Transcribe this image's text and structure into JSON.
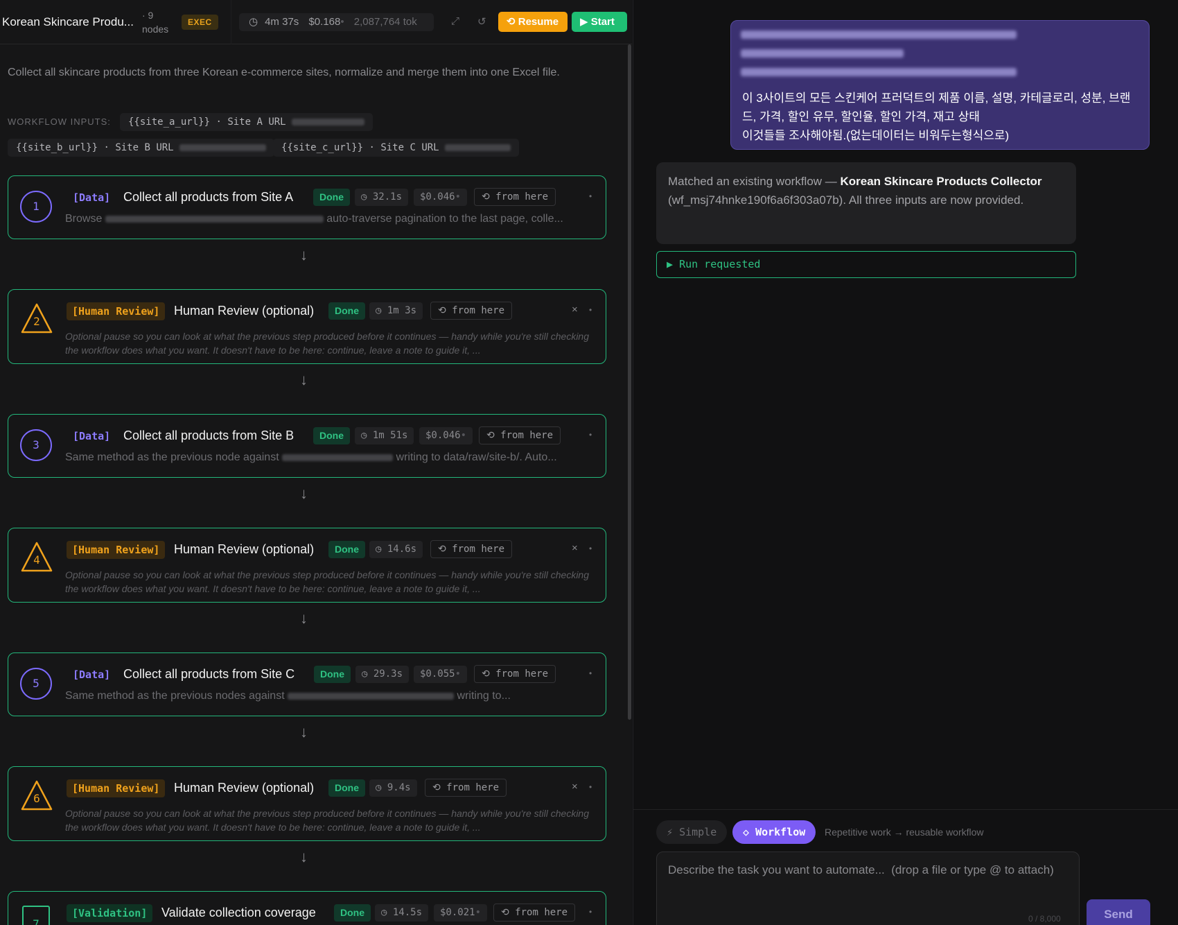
{
  "header": {
    "title": "Korean Skincare Produ...",
    "nodes_label": "· 9 nodes",
    "exec_badge": "EXEC",
    "duration": "4m 37s",
    "cost": "$0.168",
    "tokens": "2,087,764 tok",
    "resume_label": "Resume",
    "start_label": "Start"
  },
  "description": "Collect all skincare products from three Korean e-commerce sites, normalize and merge them into one Excel file.",
  "inputs": {
    "label": "WORKFLOW INPUTS:",
    "items": [
      {
        "var": "{{site_a_url}}",
        "label": "Site A URL"
      },
      {
        "var": "{{site_b_url}}",
        "label": "Site B URL"
      },
      {
        "var": "{{site_c_url}}",
        "label": "Site C URL"
      }
    ]
  },
  "steps": [
    {
      "num": "1",
      "tag": "[Data]",
      "title": "Collect all products from Site A",
      "status": "Done",
      "time": "32.1s",
      "cost": "$0.046",
      "from": "from here",
      "desc_pre": "Browse",
      "desc_post": "auto-traverse pagination to the last page, colle..."
    },
    {
      "num": "2",
      "tag": "[Human Review]",
      "title": "Human Review (optional)",
      "status": "Done",
      "time": "1m 3s",
      "from": "from here",
      "desc": "Optional pause so you can look at what the previous step produced before it continues — handy while you're still checking the workflow does what you want. It doesn't have to be here: continue, leave a note to guide it, ..."
    },
    {
      "num": "3",
      "tag": "[Data]",
      "title": "Collect all products from Site B",
      "status": "Done",
      "time": "1m 51s",
      "cost": "$0.046",
      "from": "from here",
      "desc_pre": "Same method as the previous node against",
      "desc_post": "writing to data/raw/site-b/. Auto..."
    },
    {
      "num": "4",
      "tag": "[Human Review]",
      "title": "Human Review (optional)",
      "status": "Done",
      "time": "14.6s",
      "from": "from here",
      "desc": "Optional pause so you can look at what the previous step produced before it continues — handy while you're still checking the workflow does what you want. It doesn't have to be here: continue, leave a note to guide it, ..."
    },
    {
      "num": "5",
      "tag": "[Data]",
      "title": "Collect all products from Site C",
      "status": "Done",
      "time": "29.3s",
      "cost": "$0.055",
      "from": "from here",
      "desc_pre": "Same method as the previous nodes against",
      "desc_post": "writing to..."
    },
    {
      "num": "6",
      "tag": "[Human Review]",
      "title": "Human Review (optional)",
      "status": "Done",
      "time": "9.4s",
      "from": "from here",
      "desc": "Optional pause so you can look at what the previous step produced before it continues — handy while you're still checking the workflow does what you want. It doesn't have to be here: continue, leave a note to guide it, ..."
    },
    {
      "num": "7",
      "tag": "[Validation]",
      "title": "Validate collection coverage",
      "status": "Done",
      "time": "14.5s",
      "cost": "$0.021",
      "from": "from here"
    }
  ],
  "chat": {
    "user_message": "이 3사이트의 모든 스킨케어 프러덕트의 제품 이름, 설명, 카테글로리, 성분, 브랜드, 가격, 할인 유무, 할인율, 할인 가격, 재고 상태\n이것들들 조사해야됨.(없는데이터는 비워두는형식으로)",
    "bot_pre": "Matched an existing workflow — ",
    "bot_bold": "Korean Skincare Products Collector",
    "bot_post": " (wf_msj74hnke190f6a6f303a07b). All three inputs are now provided.",
    "run_requested": "Run requested"
  },
  "composer": {
    "mode_simple": "Simple",
    "mode_workflow": "Workflow",
    "hint": "Repetitive work → reusable workflow",
    "placeholder": "Describe the task you want to automate...  (drop a file or type @ to attach)",
    "counter": "0 / 8,000",
    "send_label": "Send"
  },
  "colors": {
    "accent_green": "#23b77b",
    "accent_purple": "#7c5cf5",
    "accent_orange": "#f5a10c"
  }
}
